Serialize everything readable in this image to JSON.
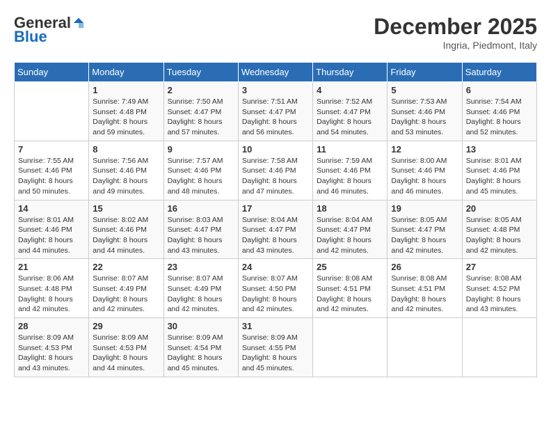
{
  "logo": {
    "general": "General",
    "blue": "Blue"
  },
  "header": {
    "month_title": "December 2025",
    "location": "Ingria, Piedmont, Italy"
  },
  "weekdays": [
    "Sunday",
    "Monday",
    "Tuesday",
    "Wednesday",
    "Thursday",
    "Friday",
    "Saturday"
  ],
  "weeks": [
    [
      {
        "day": "",
        "sunrise": "",
        "sunset": "",
        "daylight": ""
      },
      {
        "day": "1",
        "sunrise": "Sunrise: 7:49 AM",
        "sunset": "Sunset: 4:48 PM",
        "daylight": "Daylight: 8 hours and 59 minutes."
      },
      {
        "day": "2",
        "sunrise": "Sunrise: 7:50 AM",
        "sunset": "Sunset: 4:47 PM",
        "daylight": "Daylight: 8 hours and 57 minutes."
      },
      {
        "day": "3",
        "sunrise": "Sunrise: 7:51 AM",
        "sunset": "Sunset: 4:47 PM",
        "daylight": "Daylight: 8 hours and 56 minutes."
      },
      {
        "day": "4",
        "sunrise": "Sunrise: 7:52 AM",
        "sunset": "Sunset: 4:47 PM",
        "daylight": "Daylight: 8 hours and 54 minutes."
      },
      {
        "day": "5",
        "sunrise": "Sunrise: 7:53 AM",
        "sunset": "Sunset: 4:46 PM",
        "daylight": "Daylight: 8 hours and 53 minutes."
      },
      {
        "day": "6",
        "sunrise": "Sunrise: 7:54 AM",
        "sunset": "Sunset: 4:46 PM",
        "daylight": "Daylight: 8 hours and 52 minutes."
      }
    ],
    [
      {
        "day": "7",
        "sunrise": "Sunrise: 7:55 AM",
        "sunset": "Sunset: 4:46 PM",
        "daylight": "Daylight: 8 hours and 50 minutes."
      },
      {
        "day": "8",
        "sunrise": "Sunrise: 7:56 AM",
        "sunset": "Sunset: 4:46 PM",
        "daylight": "Daylight: 8 hours and 49 minutes."
      },
      {
        "day": "9",
        "sunrise": "Sunrise: 7:57 AM",
        "sunset": "Sunset: 4:46 PM",
        "daylight": "Daylight: 8 hours and 48 minutes."
      },
      {
        "day": "10",
        "sunrise": "Sunrise: 7:58 AM",
        "sunset": "Sunset: 4:46 PM",
        "daylight": "Daylight: 8 hours and 47 minutes."
      },
      {
        "day": "11",
        "sunrise": "Sunrise: 7:59 AM",
        "sunset": "Sunset: 4:46 PM",
        "daylight": "Daylight: 8 hours and 46 minutes."
      },
      {
        "day": "12",
        "sunrise": "Sunrise: 8:00 AM",
        "sunset": "Sunset: 4:46 PM",
        "daylight": "Daylight: 8 hours and 46 minutes."
      },
      {
        "day": "13",
        "sunrise": "Sunrise: 8:01 AM",
        "sunset": "Sunset: 4:46 PM",
        "daylight": "Daylight: 8 hours and 45 minutes."
      }
    ],
    [
      {
        "day": "14",
        "sunrise": "Sunrise: 8:01 AM",
        "sunset": "Sunset: 4:46 PM",
        "daylight": "Daylight: 8 hours and 44 minutes."
      },
      {
        "day": "15",
        "sunrise": "Sunrise: 8:02 AM",
        "sunset": "Sunset: 4:46 PM",
        "daylight": "Daylight: 8 hours and 44 minutes."
      },
      {
        "day": "16",
        "sunrise": "Sunrise: 8:03 AM",
        "sunset": "Sunset: 4:47 PM",
        "daylight": "Daylight: 8 hours and 43 minutes."
      },
      {
        "day": "17",
        "sunrise": "Sunrise: 8:04 AM",
        "sunset": "Sunset: 4:47 PM",
        "daylight": "Daylight: 8 hours and 43 minutes."
      },
      {
        "day": "18",
        "sunrise": "Sunrise: 8:04 AM",
        "sunset": "Sunset: 4:47 PM",
        "daylight": "Daylight: 8 hours and 42 minutes."
      },
      {
        "day": "19",
        "sunrise": "Sunrise: 8:05 AM",
        "sunset": "Sunset: 4:47 PM",
        "daylight": "Daylight: 8 hours and 42 minutes."
      },
      {
        "day": "20",
        "sunrise": "Sunrise: 8:05 AM",
        "sunset": "Sunset: 4:48 PM",
        "daylight": "Daylight: 8 hours and 42 minutes."
      }
    ],
    [
      {
        "day": "21",
        "sunrise": "Sunrise: 8:06 AM",
        "sunset": "Sunset: 4:48 PM",
        "daylight": "Daylight: 8 hours and 42 minutes."
      },
      {
        "day": "22",
        "sunrise": "Sunrise: 8:07 AM",
        "sunset": "Sunset: 4:49 PM",
        "daylight": "Daylight: 8 hours and 42 minutes."
      },
      {
        "day": "23",
        "sunrise": "Sunrise: 8:07 AM",
        "sunset": "Sunset: 4:49 PM",
        "daylight": "Daylight: 8 hours and 42 minutes."
      },
      {
        "day": "24",
        "sunrise": "Sunrise: 8:07 AM",
        "sunset": "Sunset: 4:50 PM",
        "daylight": "Daylight: 8 hours and 42 minutes."
      },
      {
        "day": "25",
        "sunrise": "Sunrise: 8:08 AM",
        "sunset": "Sunset: 4:51 PM",
        "daylight": "Daylight: 8 hours and 42 minutes."
      },
      {
        "day": "26",
        "sunrise": "Sunrise: 8:08 AM",
        "sunset": "Sunset: 4:51 PM",
        "daylight": "Daylight: 8 hours and 42 minutes."
      },
      {
        "day": "27",
        "sunrise": "Sunrise: 8:08 AM",
        "sunset": "Sunset: 4:52 PM",
        "daylight": "Daylight: 8 hours and 43 minutes."
      }
    ],
    [
      {
        "day": "28",
        "sunrise": "Sunrise: 8:09 AM",
        "sunset": "Sunset: 4:53 PM",
        "daylight": "Daylight: 8 hours and 43 minutes."
      },
      {
        "day": "29",
        "sunrise": "Sunrise: 8:09 AM",
        "sunset": "Sunset: 4:53 PM",
        "daylight": "Daylight: 8 hours and 44 minutes."
      },
      {
        "day": "30",
        "sunrise": "Sunrise: 8:09 AM",
        "sunset": "Sunset: 4:54 PM",
        "daylight": "Daylight: 8 hours and 45 minutes."
      },
      {
        "day": "31",
        "sunrise": "Sunrise: 8:09 AM",
        "sunset": "Sunset: 4:55 PM",
        "daylight": "Daylight: 8 hours and 45 minutes."
      },
      {
        "day": "",
        "sunrise": "",
        "sunset": "",
        "daylight": ""
      },
      {
        "day": "",
        "sunrise": "",
        "sunset": "",
        "daylight": ""
      },
      {
        "day": "",
        "sunrise": "",
        "sunset": "",
        "daylight": ""
      }
    ]
  ]
}
